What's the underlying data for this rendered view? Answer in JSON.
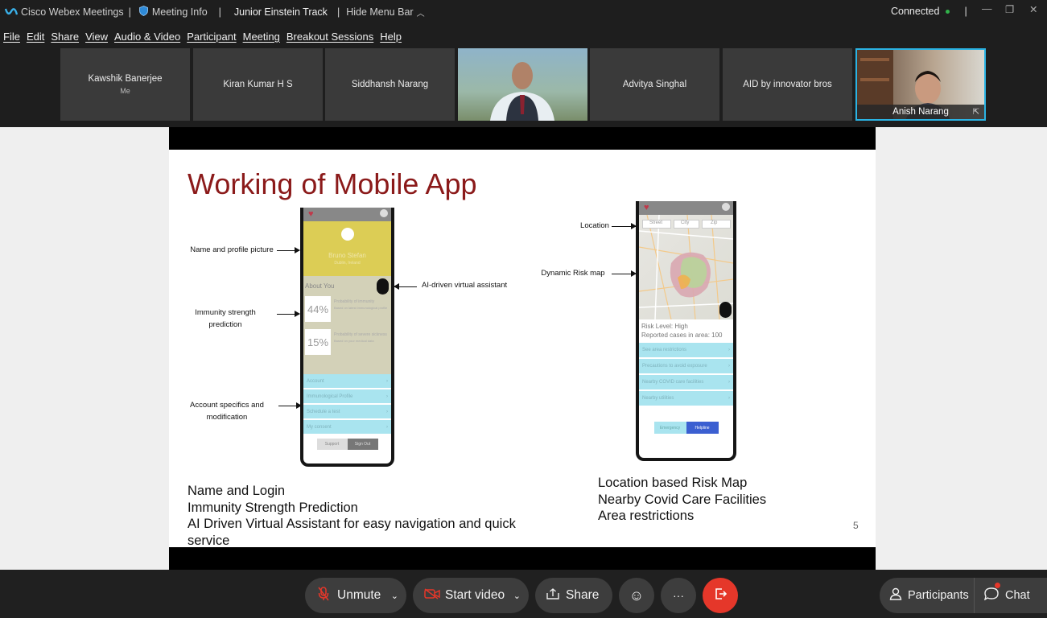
{
  "titlebar": {
    "app_name": "Cisco Webex Meetings",
    "meeting_info": "Meeting Info",
    "meeting_title": "Junior Einstein Track",
    "hide_menu": "Hide Menu Bar",
    "status": "Connected",
    "status_color": "#31b24a"
  },
  "menu": [
    "File",
    "Edit",
    "Share",
    "View",
    "Audio & Video",
    "Participant",
    "Meeting",
    "Breakout Sessions",
    "Help"
  ],
  "participants": [
    {
      "name": "Kawshik Banerjee",
      "sub": "Me"
    },
    {
      "name": "Kiran Kumar H S"
    },
    {
      "name": "Siddhansh Narang"
    },
    {
      "name": "",
      "video": true
    },
    {
      "name": "Advitya Singhal"
    },
    {
      "name": "AID by innovator bros"
    },
    {
      "name": "Anish Narang",
      "video": true,
      "active": true
    }
  ],
  "slide": {
    "title": "Working of Mobile App",
    "page_number": "5",
    "left_annotations": {
      "name_profile": "Name and profile picture",
      "immunity_1": "Immunity strength",
      "immunity_2": "prediction",
      "account_1": "Account specifics and",
      "account_2": "modification",
      "assistant": "AI-driven virtual assistant"
    },
    "right_annotations": {
      "location": "Location",
      "risk_map": "Dynamic Risk map"
    },
    "phone1": {
      "user_name": "Bruno Stefan",
      "user_sub": "Dublin, Ireland",
      "about": "About You",
      "stat1_value": "44%",
      "stat1_title": "Probability of immunity",
      "stat1_sub": "Based on latest immunological profile",
      "stat2_value": "15%",
      "stat2_title": "Probability of severe sickness",
      "stat2_sub": "Based on your medical data",
      "menu": [
        "Account",
        "Immunological Profile",
        "Schedule a test",
        "My consent"
      ],
      "btn_support": "Support",
      "btn_signout": "Sign Out"
    },
    "phone2": {
      "fields": [
        "Street",
        "City",
        "Zip"
      ],
      "risk_level": "Risk Level: High",
      "reported": "Reported cases in area: 100",
      "menu": [
        "See area restrictions",
        "Precautions to avoid exposure",
        "Nearby COVID care facilities",
        "Nearby utilities"
      ],
      "btn_emergency": "Emergency",
      "btn_helpline": "Helpline"
    },
    "bullets_left": [
      "Name and Login",
      "Immunity Strength Prediction",
      "AI Driven Virtual Assistant for easy navigation and quick service"
    ],
    "bullets_right": [
      "Location based Risk Map",
      "Nearby Covid Care Facilities",
      "Area restrictions"
    ]
  },
  "controls": {
    "unmute": "Unmute",
    "start_video": "Start video",
    "share": "Share",
    "more": "···",
    "participants": "Participants",
    "chat": "Chat"
  },
  "colors": {
    "accent_red": "#e5372a",
    "active_border": "#2bb3e3",
    "title_red": "#8b1a1a"
  }
}
